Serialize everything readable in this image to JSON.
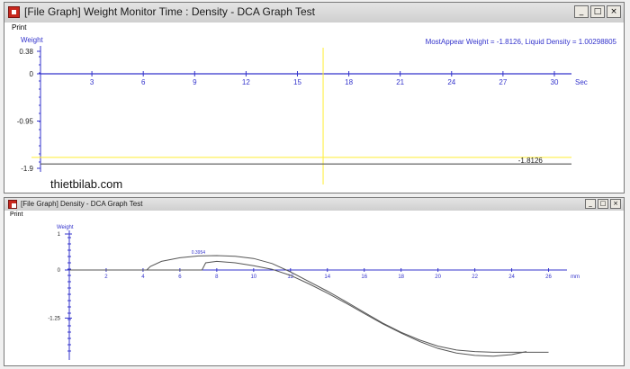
{
  "top_window": {
    "title": "[File Graph] Weight Monitor Time : Density - DCA Graph Test",
    "menu": {
      "print_label": "Print"
    },
    "window_buttons": {
      "minimize": "_",
      "maximize": "□",
      "close": "×"
    },
    "icons": {
      "app": "app-icon"
    }
  },
  "bottom_window": {
    "title": "[File Graph] Density - DCA Graph Test",
    "menu": {
      "print_label": "Print"
    },
    "window_buttons": {
      "minimize": "_",
      "maximize": "□",
      "close": "×"
    }
  },
  "watermark": "thietbilab.com",
  "colors": {
    "axis_blue": "#3333cc",
    "cursor_yellow": "#ffee33",
    "curve_gray": "#555555",
    "title_bar": "#d9d9d9"
  },
  "chart_data": [
    {
      "type": "line",
      "ylabel": "Weight",
      "xlabel": "Sec",
      "header_text": "MostAppear Weight = -1.8126, Liquid Density = 1.00298805",
      "x_ticks": [
        "3",
        "6",
        "9",
        "12",
        "15",
        "18",
        "21",
        "24",
        "27",
        "30"
      ],
      "y_ticks": [
        "0.38",
        "0",
        "-0.95",
        "-1.9"
      ],
      "xlim": [
        0,
        31
      ],
      "ylim": [
        -1.9,
        0.38
      ],
      "cursor_x": 16.5,
      "cursor_y": -1.68,
      "series": [
        {
          "x": [
            0,
            31
          ],
          "y": [
            -1.8126,
            -1.8126
          ]
        }
      ],
      "value_label": "-1.8126",
      "value_label_at": [
        28.6,
        -1.74
      ]
    },
    {
      "type": "line",
      "ylabel": "Weight",
      "xlabel": "mm",
      "x_ticks": [
        "2",
        "4",
        "6",
        "8",
        "10",
        "12",
        "14",
        "16",
        "18",
        "20",
        "22",
        "24",
        "26"
      ],
      "y_ticks": [
        "1",
        "0",
        "-1.25"
      ],
      "xlim": [
        0,
        27
      ],
      "ylim": [
        -2.2,
        1
      ],
      "peak_label": "0.3954",
      "peak_label_at": [
        7,
        0.45
      ],
      "series": [
        {
          "x": [
            0,
            4.2,
            4.4,
            5,
            6,
            7,
            8,
            9,
            10,
            11,
            12,
            13,
            14,
            15,
            16,
            17,
            18,
            19,
            20,
            21,
            22,
            23,
            24,
            25,
            26
          ],
          "y": [
            0,
            0,
            0.1,
            0.24,
            0.34,
            0.39,
            0.4,
            0.38,
            0.32,
            0.18,
            -0.05,
            -0.3,
            -0.55,
            -0.82,
            -1.1,
            -1.38,
            -1.62,
            -1.82,
            -1.98,
            -2.08,
            -2.12,
            -2.14,
            -2.14,
            -2.14,
            -2.14
          ]
        },
        {
          "x": [
            0,
            7.2,
            7.4,
            8,
            9,
            10,
            11,
            12,
            13,
            14,
            15,
            16,
            17,
            18,
            19,
            20,
            21,
            22,
            23,
            24,
            24.8
          ],
          "y": [
            0,
            0,
            0.2,
            0.24,
            0.2,
            0.12,
            0.02,
            -0.14,
            -0.36,
            -0.6,
            -0.86,
            -1.13,
            -1.4,
            -1.64,
            -1.86,
            -2.04,
            -2.16,
            -2.22,
            -2.24,
            -2.2,
            -2.12
          ]
        }
      ]
    }
  ]
}
